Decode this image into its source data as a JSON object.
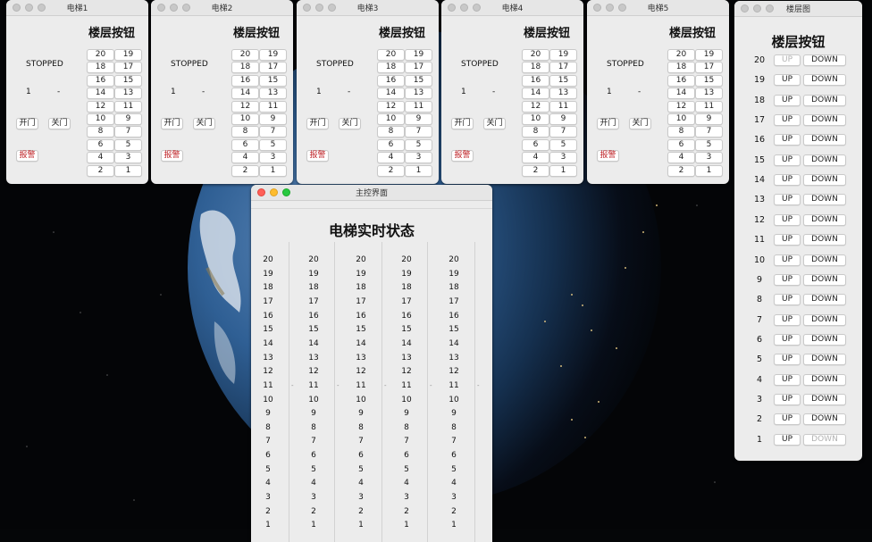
{
  "elevators": [
    {
      "title": "电梯1",
      "heading": "楼层按钮",
      "status": "STOPPED",
      "floor": "1",
      "direction": "-",
      "open_label": "开门",
      "close_label": "关门",
      "alarm_label": "报警"
    },
    {
      "title": "电梯2",
      "heading": "楼层按钮",
      "status": "STOPPED",
      "floor": "1",
      "direction": "-",
      "open_label": "开门",
      "close_label": "关门",
      "alarm_label": "报警"
    },
    {
      "title": "电梯3",
      "heading": "楼层按钮",
      "status": "STOPPED",
      "floor": "1",
      "direction": "-",
      "open_label": "开门",
      "close_label": "关门",
      "alarm_label": "报警"
    },
    {
      "title": "电梯4",
      "heading": "楼层按钮",
      "status": "STOPPED",
      "floor": "1",
      "direction": "-",
      "open_label": "开门",
      "close_label": "关门",
      "alarm_label": "报警"
    },
    {
      "title": "电梯5",
      "heading": "楼层按钮",
      "status": "STOPPED",
      "floor": "1",
      "direction": "-",
      "open_label": "开门",
      "close_label": "关门",
      "alarm_label": "报警"
    }
  ],
  "floor_buttons": [
    "20",
    "19",
    "18",
    "17",
    "16",
    "15",
    "14",
    "13",
    "12",
    "11",
    "10",
    "9",
    "8",
    "7",
    "6",
    "5",
    "4",
    "3",
    "2",
    "1"
  ],
  "floor_panel": {
    "title": "楼层图",
    "heading": "楼层按钮",
    "up_label": "UP",
    "down_label": "DOWN",
    "floors": [
      "20",
      "19",
      "18",
      "17",
      "16",
      "15",
      "14",
      "13",
      "12",
      "11",
      "10",
      "9",
      "8",
      "7",
      "6",
      "5",
      "4",
      "3",
      "2",
      "1"
    ]
  },
  "main": {
    "title": "主控界面",
    "heading": "电梯实时状态",
    "column_count": 5,
    "floors": [
      "20",
      "19",
      "18",
      "17",
      "16",
      "15",
      "14",
      "13",
      "12",
      "11",
      "10",
      "9",
      "8",
      "7",
      "6",
      "5",
      "4",
      "3",
      "2",
      "1"
    ],
    "marker": "-"
  },
  "colors": {
    "alarm": "#c0262a",
    "window_bg": "#ececec"
  },
  "icons": [
    "close-icon",
    "minimize-icon",
    "zoom-icon"
  ]
}
